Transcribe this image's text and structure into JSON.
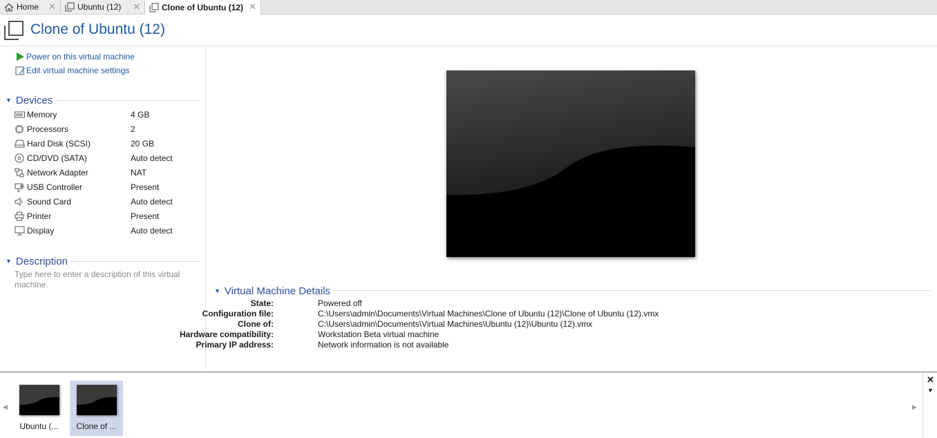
{
  "tabs": [
    {
      "label": "Home",
      "icon": "home-icon",
      "close": "✕"
    },
    {
      "label": "Ubuntu (12)",
      "icon": "vm-icon",
      "close": "✕"
    },
    {
      "label": "Clone of Ubuntu (12)",
      "icon": "vm-icon",
      "close": "✕",
      "active": true
    }
  ],
  "header": {
    "title": "Clone of Ubuntu (12)",
    "icon": "vm-icon"
  },
  "actions": {
    "power_on": "Power on this virtual machine",
    "edit_settings": "Edit virtual machine settings"
  },
  "devices": {
    "heading": "Devices",
    "items": [
      {
        "name": "Memory",
        "value": "4 GB",
        "icon": "memory-icon"
      },
      {
        "name": "Processors",
        "value": "2",
        "icon": "processor-icon"
      },
      {
        "name": "Hard Disk (SCSI)",
        "value": "20 GB",
        "icon": "hard-disk-icon"
      },
      {
        "name": "CD/DVD (SATA)",
        "value": "Auto detect",
        "icon": "cd-dvd-icon"
      },
      {
        "name": "Network Adapter",
        "value": "NAT",
        "icon": "network-adapter-icon"
      },
      {
        "name": "USB Controller",
        "value": "Present",
        "icon": "usb-icon"
      },
      {
        "name": "Sound Card",
        "value": "Auto detect",
        "icon": "speaker-icon"
      },
      {
        "name": "Printer",
        "value": "Present",
        "icon": "printer-icon"
      },
      {
        "name": "Display",
        "value": "Auto detect",
        "icon": "display-icon"
      }
    ]
  },
  "description": {
    "heading": "Description",
    "placeholder": "Type here to enter a description of this virtual machine."
  },
  "details": {
    "heading": "Virtual Machine Details",
    "rows": [
      {
        "label": "State:",
        "value": "Powered off"
      },
      {
        "label": "Configuration file:",
        "value": "C:\\Users\\admin\\Documents\\Virtual Machines\\Clone of Ubuntu (12)\\Clone of Ubuntu (12).vmx"
      },
      {
        "label": "Clone of:",
        "value": "C:\\Users\\admin\\Documents\\Virtual Machines\\Ubuntu (12)\\Ubuntu (12).vmx"
      },
      {
        "label": "Hardware compatibility:",
        "value": "Workstation Beta virtual machine"
      },
      {
        "label": "Primary IP address:",
        "value": "Network information is not available"
      }
    ]
  },
  "thumbnails": [
    {
      "label": "Ubuntu (..."
    },
    {
      "label": "Clone of ...",
      "selected": true
    }
  ],
  "thumbnail_bar": {
    "close": "✕",
    "menu": "▼",
    "scroll_left": "◀",
    "scroll_right": "▶"
  },
  "colors": {
    "accent": "#1e5aa0",
    "section": "#2e4d9c",
    "selected": "#cfd8ea",
    "power": "#2e9a2e"
  }
}
